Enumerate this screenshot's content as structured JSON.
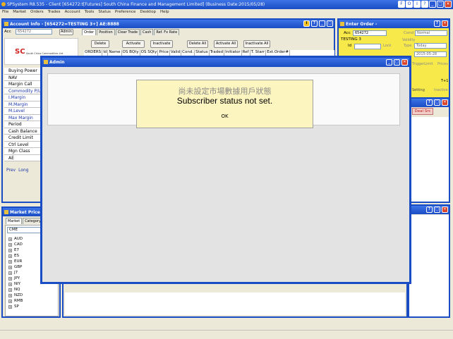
{
  "app": {
    "title": "SPSystem R8.535 - Client [654272:t[Futures] South China Finance and Management Limited] (Business Date:2015/05/28)",
    "menu": [
      "File",
      "Market",
      "Orders",
      "Trades",
      "Account",
      "Tools",
      "Status",
      "Preference",
      "Desktop",
      "Help"
    ],
    "title_buttons": [
      "F",
      "O",
      "I",
      "?"
    ]
  },
  "account_info": {
    "title": "Account Info - [654272=TESTING 3+] AE:8888",
    "acc_label": "Acc",
    "acc_value": "654272",
    "admin_button": "Admin",
    "logo_text": "SC",
    "logo_sub": "South China Commodities Ltd.",
    "tabs": [
      "Order",
      "Position",
      "Clear Trade",
      "Cash",
      "Ref. Fx Rate"
    ],
    "action_buttons": [
      "Delete",
      "Activate",
      "Inactivate",
      "Delete All",
      "Activate All",
      "Inactivate All"
    ],
    "order_columns": [
      "ORDERS",
      "Id",
      "Name",
      "OS BQty",
      "OS SQty",
      "Price",
      "Valid",
      "Cond.",
      "Status",
      "Traded",
      "Initiator",
      "Ref",
      "T. Starr",
      "Ext.Order#"
    ],
    "left_rows": [
      "Buying Power",
      "NAV",
      "Margin Call",
      "Commodity P/L",
      "I.Margin",
      "M.Margin",
      "M.Level",
      "Max Margin",
      "Period",
      "Cash Balance",
      "Credit Limit",
      "Ctrl Level",
      "Mgn Class",
      "AE"
    ],
    "pos_tabs": [
      "Prev",
      "Long"
    ]
  },
  "enter_order": {
    "title": "Enter Order -",
    "acc_label": "Acc",
    "acc_value": "654272",
    "cond_label": "Cond",
    "cond_value": "Normal",
    "account_name": "TESTING 3",
    "id_label": "Id",
    "lock_label": "Lock",
    "validity_label": "Validity",
    "type_label": "Type",
    "type_value": "Today",
    "date_value": "2015-05-28",
    "trigger_label": "TriggerLimit",
    "prices_label": "Prices",
    "setting_label": "Setting",
    "inactive_label": "Inactive",
    "t1_label": "T+1",
    "deal_src": "Deal Src"
  },
  "market_price": {
    "title": "Market Price",
    "tabs": [
      "Market",
      "Category"
    ],
    "selected_market": "CME",
    "items": [
      "AUD",
      "CAD",
      "E7",
      "ES",
      "EUR",
      "GBP",
      "J7",
      "JPY",
      "NIY",
      "NQ",
      "NZD",
      "RMB",
      "SP"
    ]
  },
  "admin_dialog": {
    "title": "Admin",
    "message_zh": "尚未設定市場數據用戶狀態",
    "message_en": "Subscriber status not set.",
    "ok_label": "OK"
  }
}
